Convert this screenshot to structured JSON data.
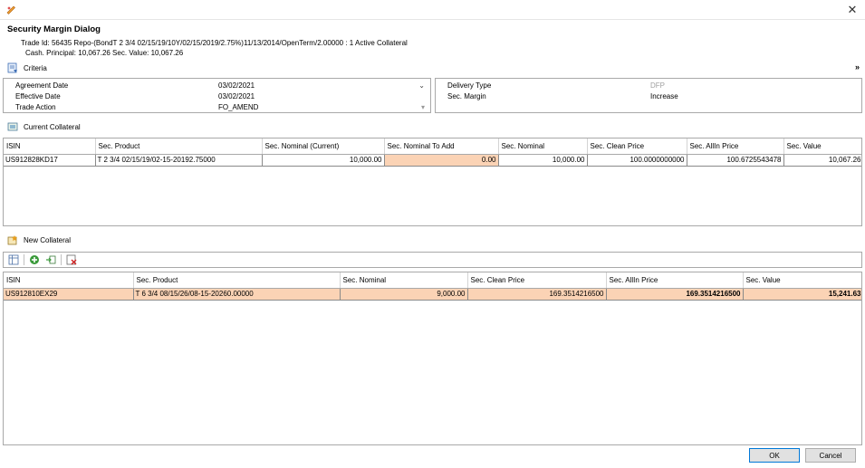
{
  "window": {
    "close_glyph": "✕"
  },
  "dialog": {
    "title": "Security Margin Dialog",
    "trade_line": "Trade Id: 56435 Repo-(BondT 2 3/4 02/15/19/10Y/02/15/2019/2.75%)11/13/2014/OpenTerm/2.00000 : 1 Active Collateral",
    "cash_line": "Cash. Principal: 10,067.26  Sec. Value: 10,067.26"
  },
  "criteria": {
    "header": "Criteria",
    "collapse_glyph": "»",
    "left": [
      {
        "label": "Agreement Date",
        "value": "03/02/2021",
        "dropdown": "⌄"
      },
      {
        "label": "Effective Date",
        "value": "03/02/2021",
        "dropdown": ""
      },
      {
        "label": "Trade Action",
        "value": "FO_AMEND",
        "dropdown": "▾"
      }
    ],
    "right": [
      {
        "label": "Delivery Type",
        "value": "DFP",
        "value_color": "#a0a0a0"
      },
      {
        "label": "Sec. Margin",
        "value": "Increase",
        "value_color": "#000000"
      }
    ]
  },
  "current_collateral": {
    "header": "Current Collateral",
    "columns": [
      "ISIN",
      "Sec. Product",
      "Sec. Nominal (Current)",
      "Sec. Nominal To Add",
      "Sec. Nominal",
      "Sec. Clean Price",
      "Sec. AllIn Price",
      "Sec. Value"
    ],
    "rows": [
      [
        "US912828KD17",
        "T 2 3/4 02/15/19/02-15-20192.75000",
        "10,000.00",
        "0.00",
        "10,000.00",
        "100.0000000000",
        "100.6725543478",
        "10,067.26"
      ]
    ]
  },
  "new_collateral": {
    "header": "New Collateral",
    "columns": [
      "ISIN",
      "Sec. Product",
      "Sec. Nominal",
      "Sec. Clean Price",
      "Sec. AllIn Price",
      "Sec. Value"
    ],
    "rows": [
      [
        "US912810EX29",
        "T 6 3/4 08/15/26/08-15-20260.00000",
        "9,000.00",
        "169.3514216500",
        "169.3514216500",
        "15,241.63"
      ]
    ]
  },
  "buttons": {
    "ok": "OK",
    "cancel": "Cancel"
  },
  "colors": {
    "highlight": "#fbd3b5",
    "border": "#a9a9a9",
    "accent": "#0078d7"
  }
}
